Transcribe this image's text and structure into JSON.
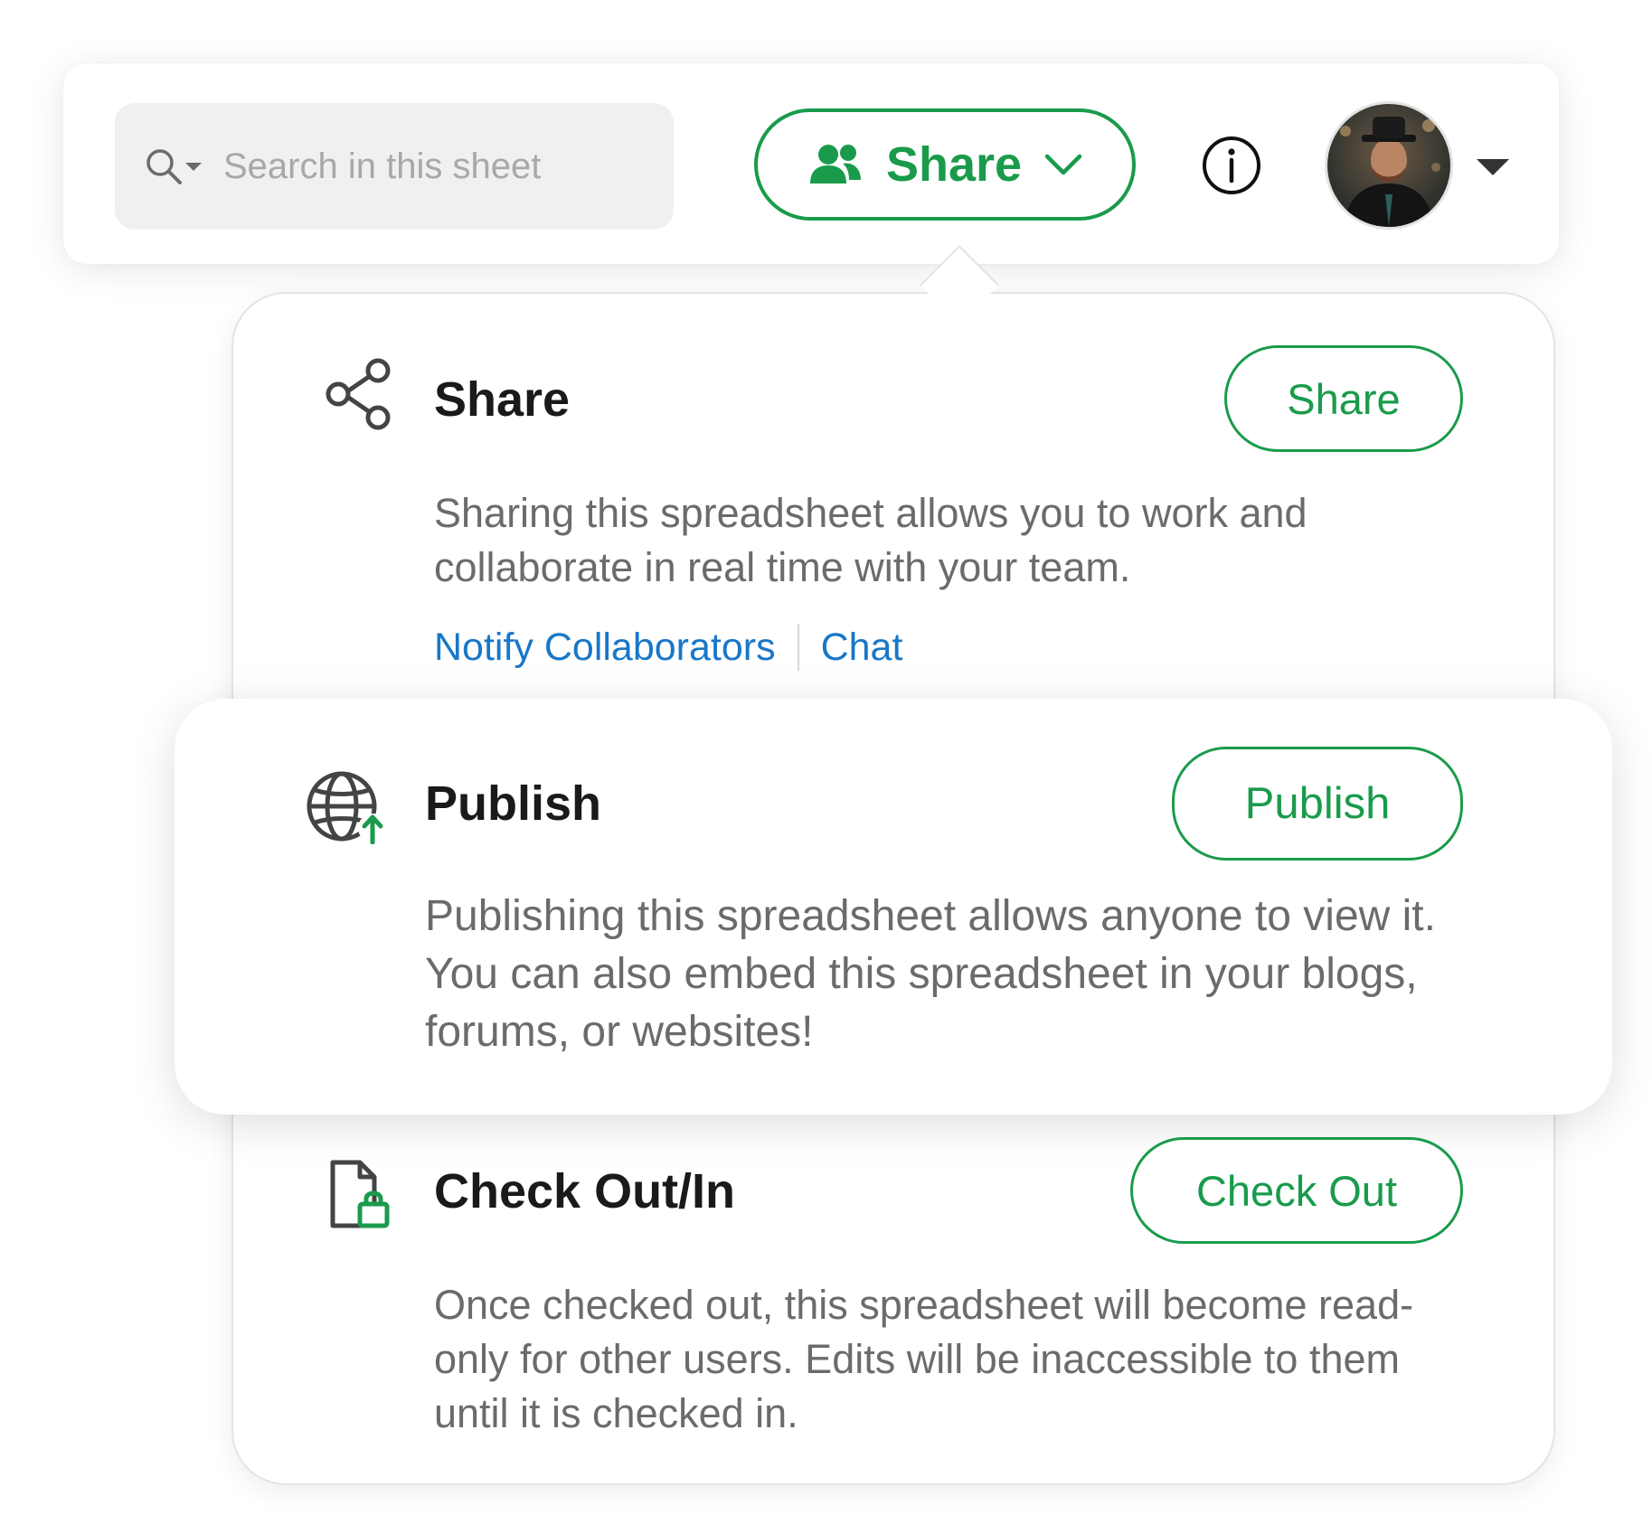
{
  "search": {
    "placeholder": "Search in this sheet"
  },
  "header": {
    "share_button_label": "Share",
    "info_icon": "info-icon",
    "avatar_icon": "user-avatar",
    "avatar_menu_icon": "caret-down-icon"
  },
  "share_section": {
    "icon": "share-nodes-icon",
    "title": "Share",
    "button_label": "Share",
    "description": "Sharing this spreadsheet allows you to work and collaborate in real time with your team.",
    "links": [
      "Notify Collaborators",
      "Chat"
    ]
  },
  "publish_section": {
    "icon": "globe-upload-icon",
    "title": "Publish",
    "button_label": "Publish",
    "description": "Publishing this spreadsheet allows anyone to view it. You can also embed this spreadsheet in your blogs, forums, or websites!"
  },
  "checkout_section": {
    "icon": "file-lock-icon",
    "title": "Check Out/In",
    "button_label": "Check Out",
    "description": "Once checked out, this spreadsheet will become read-only for other users. Edits will be inaccessible to them until it is checked in."
  },
  "colors": {
    "accent_green": "#1a9b4b",
    "link_blue": "#1877c8",
    "text_gray": "#6b6b6b"
  }
}
